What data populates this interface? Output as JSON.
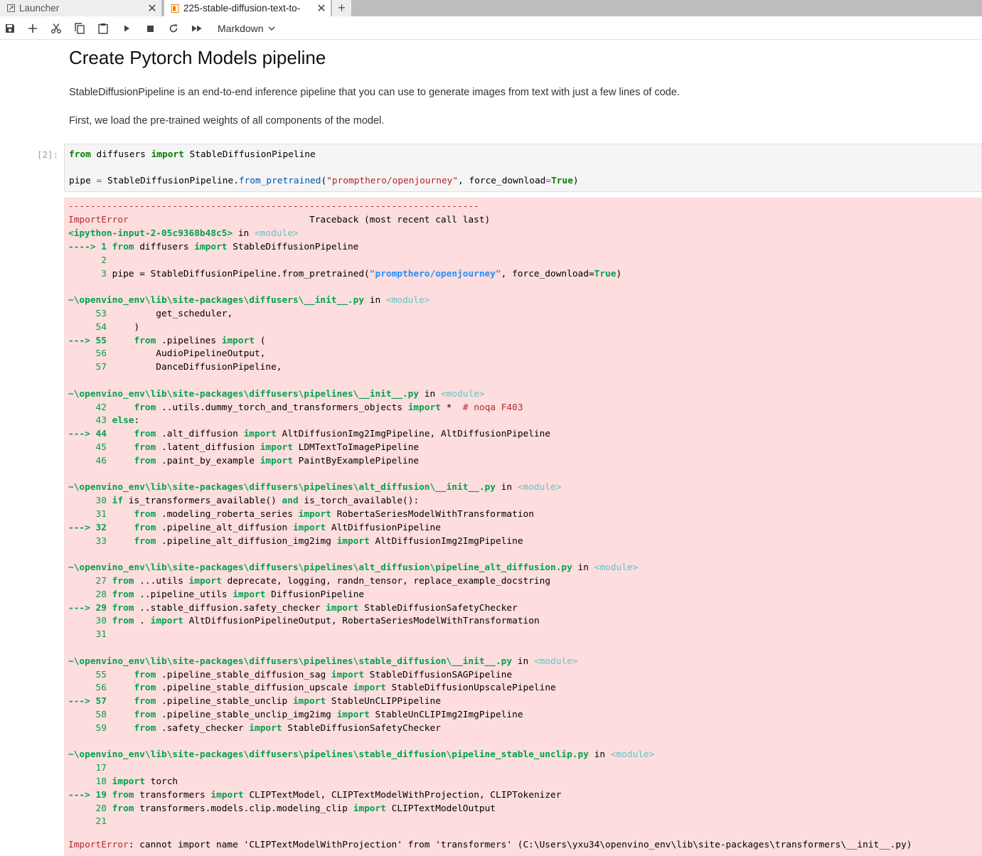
{
  "tabs": {
    "launcher": "Launcher",
    "notebook": "225-stable-diffusion-text-to-",
    "close": "✕",
    "new": "+"
  },
  "toolbar": {
    "cell_type": "Markdown"
  },
  "markdown": {
    "title": "Create Pytorch Models pipeline",
    "p1": "StableDiffusionPipeline is an end-to-end inference pipeline that you can use to generate images from text with just a few lines of code.",
    "p2": "First, we load the pre-trained weights of all components of the model."
  },
  "cell": {
    "prompt": "[2]:",
    "line1": {
      "kw1": "from",
      "mod": " diffusers ",
      "kw2": "import",
      "name": " StableDiffusionPipeline"
    },
    "line2": {
      "pre": "pipe ",
      "eq": "=",
      "cls": " StableDiffusionPipeline.",
      "fn": "from_pretrained",
      "open": "(",
      "str": "\"prompthero/openjourney\"",
      "mid": ", force_download",
      "eq2": "=",
      "val": "True",
      "close": ")"
    }
  },
  "error": {
    "rule": "---------------------------------------------------------------------------",
    "type": "ImportError",
    "traceback": "                                 Traceback (most recent call last)",
    "input_file": "<ipython-input-2-05c9368b48c5>",
    "in": " in ",
    "module": "<module>",
    "frames": [
      {
        "path": "~\\openvino_env\\lib\\site-packages\\diffusers\\__init__.py",
        "lines": [
          {
            "arrow": "     ",
            "no": "53",
            "code": "         get_scheduler,"
          },
          {
            "arrow": "     ",
            "no": "54",
            "code": "     )"
          },
          {
            "arrow": "---> ",
            "no": "55",
            "code": "     from .pipelines import ("
          },
          {
            "arrow": "     ",
            "no": "56",
            "code": "         AudioPipelineOutput,"
          },
          {
            "arrow": "     ",
            "no": "57",
            "code": "         DanceDiffusionPipeline,"
          }
        ]
      },
      {
        "path": "~\\openvino_env\\lib\\site-packages\\diffusers\\pipelines\\__init__.py",
        "lines": [
          {
            "arrow": "     ",
            "no": "42",
            "code": "     from ..utils.dummy_torch_and_transformers_objects import *  # noqa F403"
          },
          {
            "arrow": "     ",
            "no": "43",
            "code": " else:"
          },
          {
            "arrow": "---> ",
            "no": "44",
            "code": "     from .alt_diffusion import AltDiffusionImg2ImgPipeline, AltDiffusionPipeline"
          },
          {
            "arrow": "     ",
            "no": "45",
            "code": "     from .latent_diffusion import LDMTextToImagePipeline"
          },
          {
            "arrow": "     ",
            "no": "46",
            "code": "     from .paint_by_example import PaintByExamplePipeline"
          }
        ]
      },
      {
        "path": "~\\openvino_env\\lib\\site-packages\\diffusers\\pipelines\\alt_diffusion\\__init__.py",
        "lines": [
          {
            "arrow": "     ",
            "no": "30",
            "code": " if is_transformers_available() and is_torch_available():"
          },
          {
            "arrow": "     ",
            "no": "31",
            "code": "     from .modeling_roberta_series import RobertaSeriesModelWithTransformation"
          },
          {
            "arrow": "---> ",
            "no": "32",
            "code": "     from .pipeline_alt_diffusion import AltDiffusionPipeline"
          },
          {
            "arrow": "     ",
            "no": "33",
            "code": "     from .pipeline_alt_diffusion_img2img import AltDiffusionImg2ImgPipeline"
          }
        ]
      },
      {
        "path": "~\\openvino_env\\lib\\site-packages\\diffusers\\pipelines\\alt_diffusion\\pipeline_alt_diffusion.py",
        "lines": [
          {
            "arrow": "     ",
            "no": "27",
            "code": " from ...utils import deprecate, logging, randn_tensor, replace_example_docstring"
          },
          {
            "arrow": "     ",
            "no": "28",
            "code": " from ..pipeline_utils import DiffusionPipeline"
          },
          {
            "arrow": "---> ",
            "no": "29",
            "code": " from ..stable_diffusion.safety_checker import StableDiffusionSafetyChecker"
          },
          {
            "arrow": "     ",
            "no": "30",
            "code": " from . import AltDiffusionPipelineOutput, RobertaSeriesModelWithTransformation"
          },
          {
            "arrow": "     ",
            "no": "31",
            "code": ""
          }
        ]
      },
      {
        "path": "~\\openvino_env\\lib\\site-packages\\diffusers\\pipelines\\stable_diffusion\\__init__.py",
        "lines": [
          {
            "arrow": "     ",
            "no": "55",
            "code": "     from .pipeline_stable_diffusion_sag import StableDiffusionSAGPipeline"
          },
          {
            "arrow": "     ",
            "no": "56",
            "code": "     from .pipeline_stable_diffusion_upscale import StableDiffusionUpscalePipeline"
          },
          {
            "arrow": "---> ",
            "no": "57",
            "code": "     from .pipeline_stable_unclip import StableUnCLIPPipeline"
          },
          {
            "arrow": "     ",
            "no": "58",
            "code": "     from .pipeline_stable_unclip_img2img import StableUnCLIPImg2ImgPipeline"
          },
          {
            "arrow": "     ",
            "no": "59",
            "code": "     from .safety_checker import StableDiffusionSafetyChecker"
          }
        ]
      },
      {
        "path": "~\\openvino_env\\lib\\site-packages\\diffusers\\pipelines\\stable_diffusion\\pipeline_stable_unclip.py",
        "lines": [
          {
            "arrow": "     ",
            "no": "17",
            "code": ""
          },
          {
            "arrow": "     ",
            "no": "18",
            "code": " import torch"
          },
          {
            "arrow": "---> ",
            "no": "19",
            "code": " from transformers import CLIPTextModel, CLIPTextModelWithProjection, CLIPTokenizer"
          },
          {
            "arrow": "     ",
            "no": "20",
            "code": " from transformers.models.clip.modeling_clip import CLIPTextModelOutput"
          },
          {
            "arrow": "     ",
            "no": "21",
            "code": ""
          }
        ]
      }
    ],
    "first_frame_lines": [
      {
        "arrow": "----> ",
        "no": "1",
        "code": " from diffusers import StableDiffusionPipeline"
      },
      {
        "arrow": "      ",
        "no": "2",
        "code": ""
      },
      {
        "arrow": "      ",
        "no": "3",
        "code": " pipe = StableDiffusionPipeline.from_pretrained(\"prompthero/openjourney\", force_download=True)"
      }
    ],
    "final_type": "ImportError",
    "final_msg": ": cannot import name 'CLIPTextModelWithProjection' from 'transformers' (C:\\Users\\yxu34\\openvino_env\\lib\\site-packages\\transformers\\__init__.py)"
  }
}
